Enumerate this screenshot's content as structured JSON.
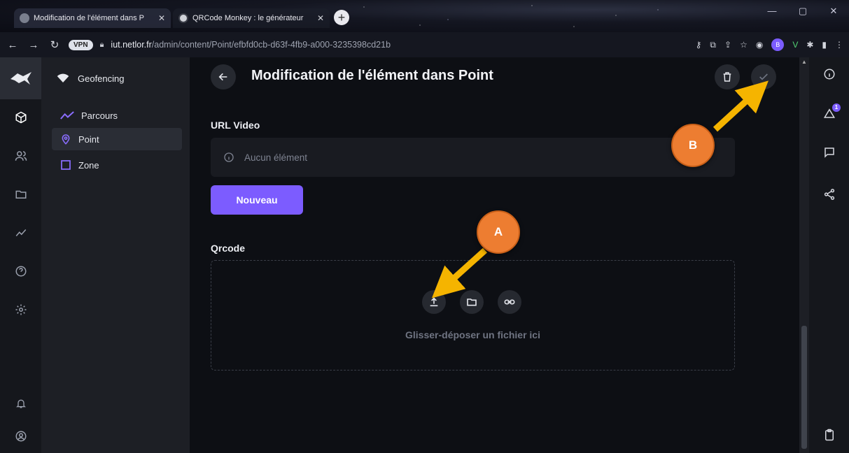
{
  "browser": {
    "tabs": [
      {
        "title": "Modification de l'élément dans P",
        "active": true
      },
      {
        "title": "QRCode Monkey : le générateur",
        "active": false
      }
    ],
    "new_tab": "+",
    "vpn_label": "VPN",
    "url_host": "iut.netlor.fr",
    "url_path": "/admin/content/Point/efbfd0cb-d63f-4fb9-a000-3235398cd21b",
    "profile_initial": "B"
  },
  "nav": {
    "project": "Geofencing",
    "items": [
      {
        "label": "Parcours",
        "icon": "trend-icon"
      },
      {
        "label": "Point",
        "icon": "location-pin-icon"
      },
      {
        "label": "Zone",
        "icon": "square-icon"
      }
    ]
  },
  "header": {
    "title": "Modification de l'élément dans Point"
  },
  "form": {
    "url_video": {
      "label": "URL Video",
      "empty_text": "Aucun élément",
      "new_button": "Nouveau"
    },
    "qrcode": {
      "label": "Qrcode",
      "drop_text": "Glisser-déposer un fichier ici"
    }
  },
  "notifications": {
    "count": "1"
  },
  "annotations": {
    "a": "A",
    "b": "B"
  },
  "colors": {
    "accent": "#7c5cff",
    "marker": "#ed7d31",
    "arrow": "#f5b400"
  }
}
